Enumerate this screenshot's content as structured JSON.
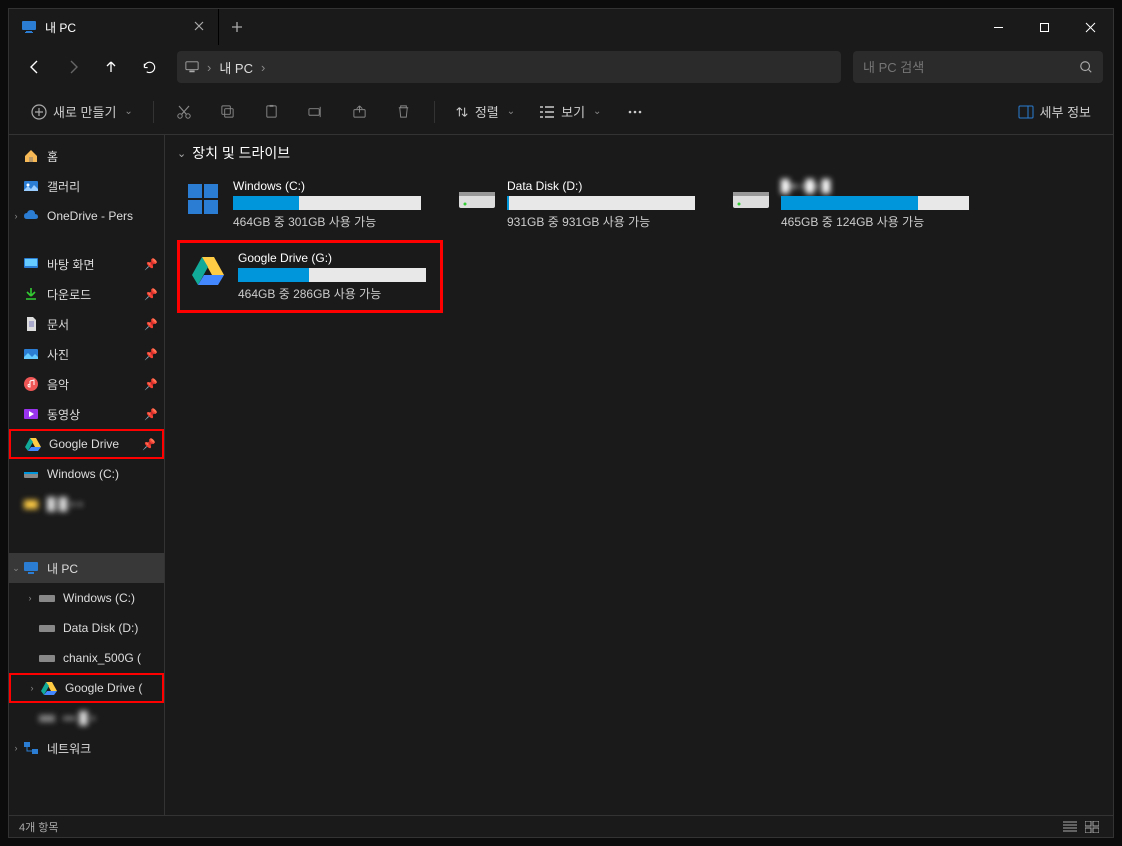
{
  "tab": {
    "title": "내 PC"
  },
  "breadcrumb": {
    "current": "내 PC"
  },
  "search": {
    "placeholder": "내 PC 검색"
  },
  "toolbar": {
    "new_label": "새로 만들기",
    "sort_label": "정렬",
    "view_label": "보기",
    "details_label": "세부 정보"
  },
  "sidebar": {
    "home": "홈",
    "gallery": "갤러리",
    "onedrive": "OneDrive - Pers",
    "quick": {
      "desktop": "바탕 화면",
      "downloads": "다운로드",
      "documents": "문서",
      "pictures": "사진",
      "music": "음악",
      "videos": "동영상",
      "gdrive": "Google Drive",
      "windows_c": "Windows (C:)",
      "obscured": "█ █ ▪ ▪"
    },
    "thispc": {
      "label": "내 PC",
      "windows_c": "Windows (C:)",
      "data_d": "Data Disk (D:)",
      "chanix": "chanix_500G (",
      "gdrive": "Google Drive (",
      "obscured": "▪▪▪ █ ▪"
    },
    "network": "네트워크"
  },
  "section": {
    "title": "장치 및 드라이브"
  },
  "drives": [
    {
      "name": "Windows (C:)",
      "status": "464GB 중 301GB 사용 가능",
      "fill_pct": 35,
      "icon": "windows"
    },
    {
      "name": "Data Disk (D:)",
      "status": "931GB 중 931GB 사용 가능",
      "fill_pct": 1,
      "icon": "hdd"
    },
    {
      "name": "█▪▪ ▪█▪ █",
      "status": "465GB 중 124GB 사용 가능",
      "fill_pct": 73,
      "icon": "hdd",
      "obscured": true
    },
    {
      "name": "Google Drive (G:)",
      "status": "464GB 중 286GB 사용 가능",
      "fill_pct": 38,
      "icon": "gdrive",
      "highlighted": true
    }
  ],
  "statusbar": {
    "count": "4개 항목"
  }
}
